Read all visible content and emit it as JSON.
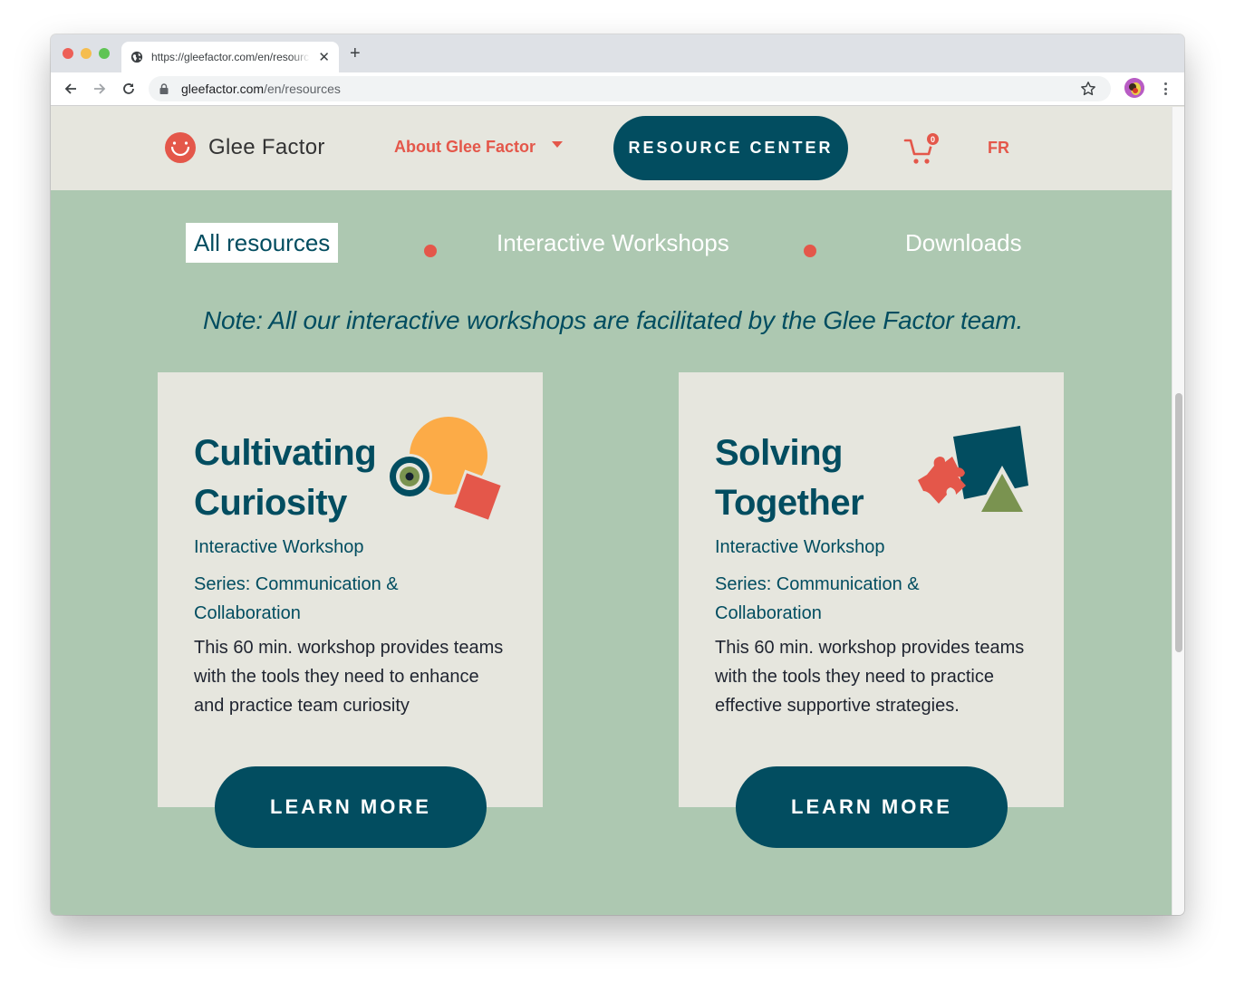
{
  "browser": {
    "tab_title": "https://gleefactor.com/en/resources",
    "url_host": "gleefactor.com",
    "url_path": "/en/resources",
    "icons": {
      "tab_favicon": "globe-icon",
      "tab_close": "close-icon",
      "new_tab": "plus-icon",
      "back": "arrow-left-icon",
      "forward": "arrow-right-icon",
      "reload": "reload-icon",
      "lock": "lock-icon",
      "bookmark": "star-icon",
      "menu": "kebab-menu-icon"
    },
    "tab_close_glyph": "✕",
    "new_tab_glyph": "+"
  },
  "header": {
    "logo_text": "Glee Factor",
    "about_label": "About Glee Factor",
    "resource_center_label": "RESOURCE CENTER",
    "cart_count": "0",
    "language_label": "FR"
  },
  "filters": [
    {
      "label": "All resources",
      "active": true
    },
    {
      "label": "Interactive Workshops",
      "active": false
    },
    {
      "label": "Downloads",
      "active": false
    }
  ],
  "note": "Note: All our interactive workshops are facilitated by the Glee Factor team.",
  "cards": [
    {
      "title_line1": "Cultivating",
      "title_line2": "Curiosity",
      "type": "Interactive Workshop",
      "series": "Series: Communication & Collaboration",
      "description": "This 60 min. workshop provides teams with the tools they need to enhance and practice team curiosity",
      "button_label": "LEARN MORE",
      "art": "circle-eye-square-illustration"
    },
    {
      "title_line1": "Solving",
      "title_line2": "Together",
      "type": "Interactive Workshop",
      "series": "Series: Communication & Collaboration",
      "description": "This 60 min. workshop provides teams with the tools they need to practice effective supportive strategies.",
      "button_label": "LEARN MORE",
      "art": "puzzle-square-triangle-illustration"
    }
  ],
  "colors": {
    "brand_teal": "#024d60",
    "brand_coral": "#e4574a",
    "page_green": "#adc8b1",
    "card_bg": "#e6e6de",
    "accent_orange": "#fcab47",
    "accent_olive": "#7a9350"
  }
}
